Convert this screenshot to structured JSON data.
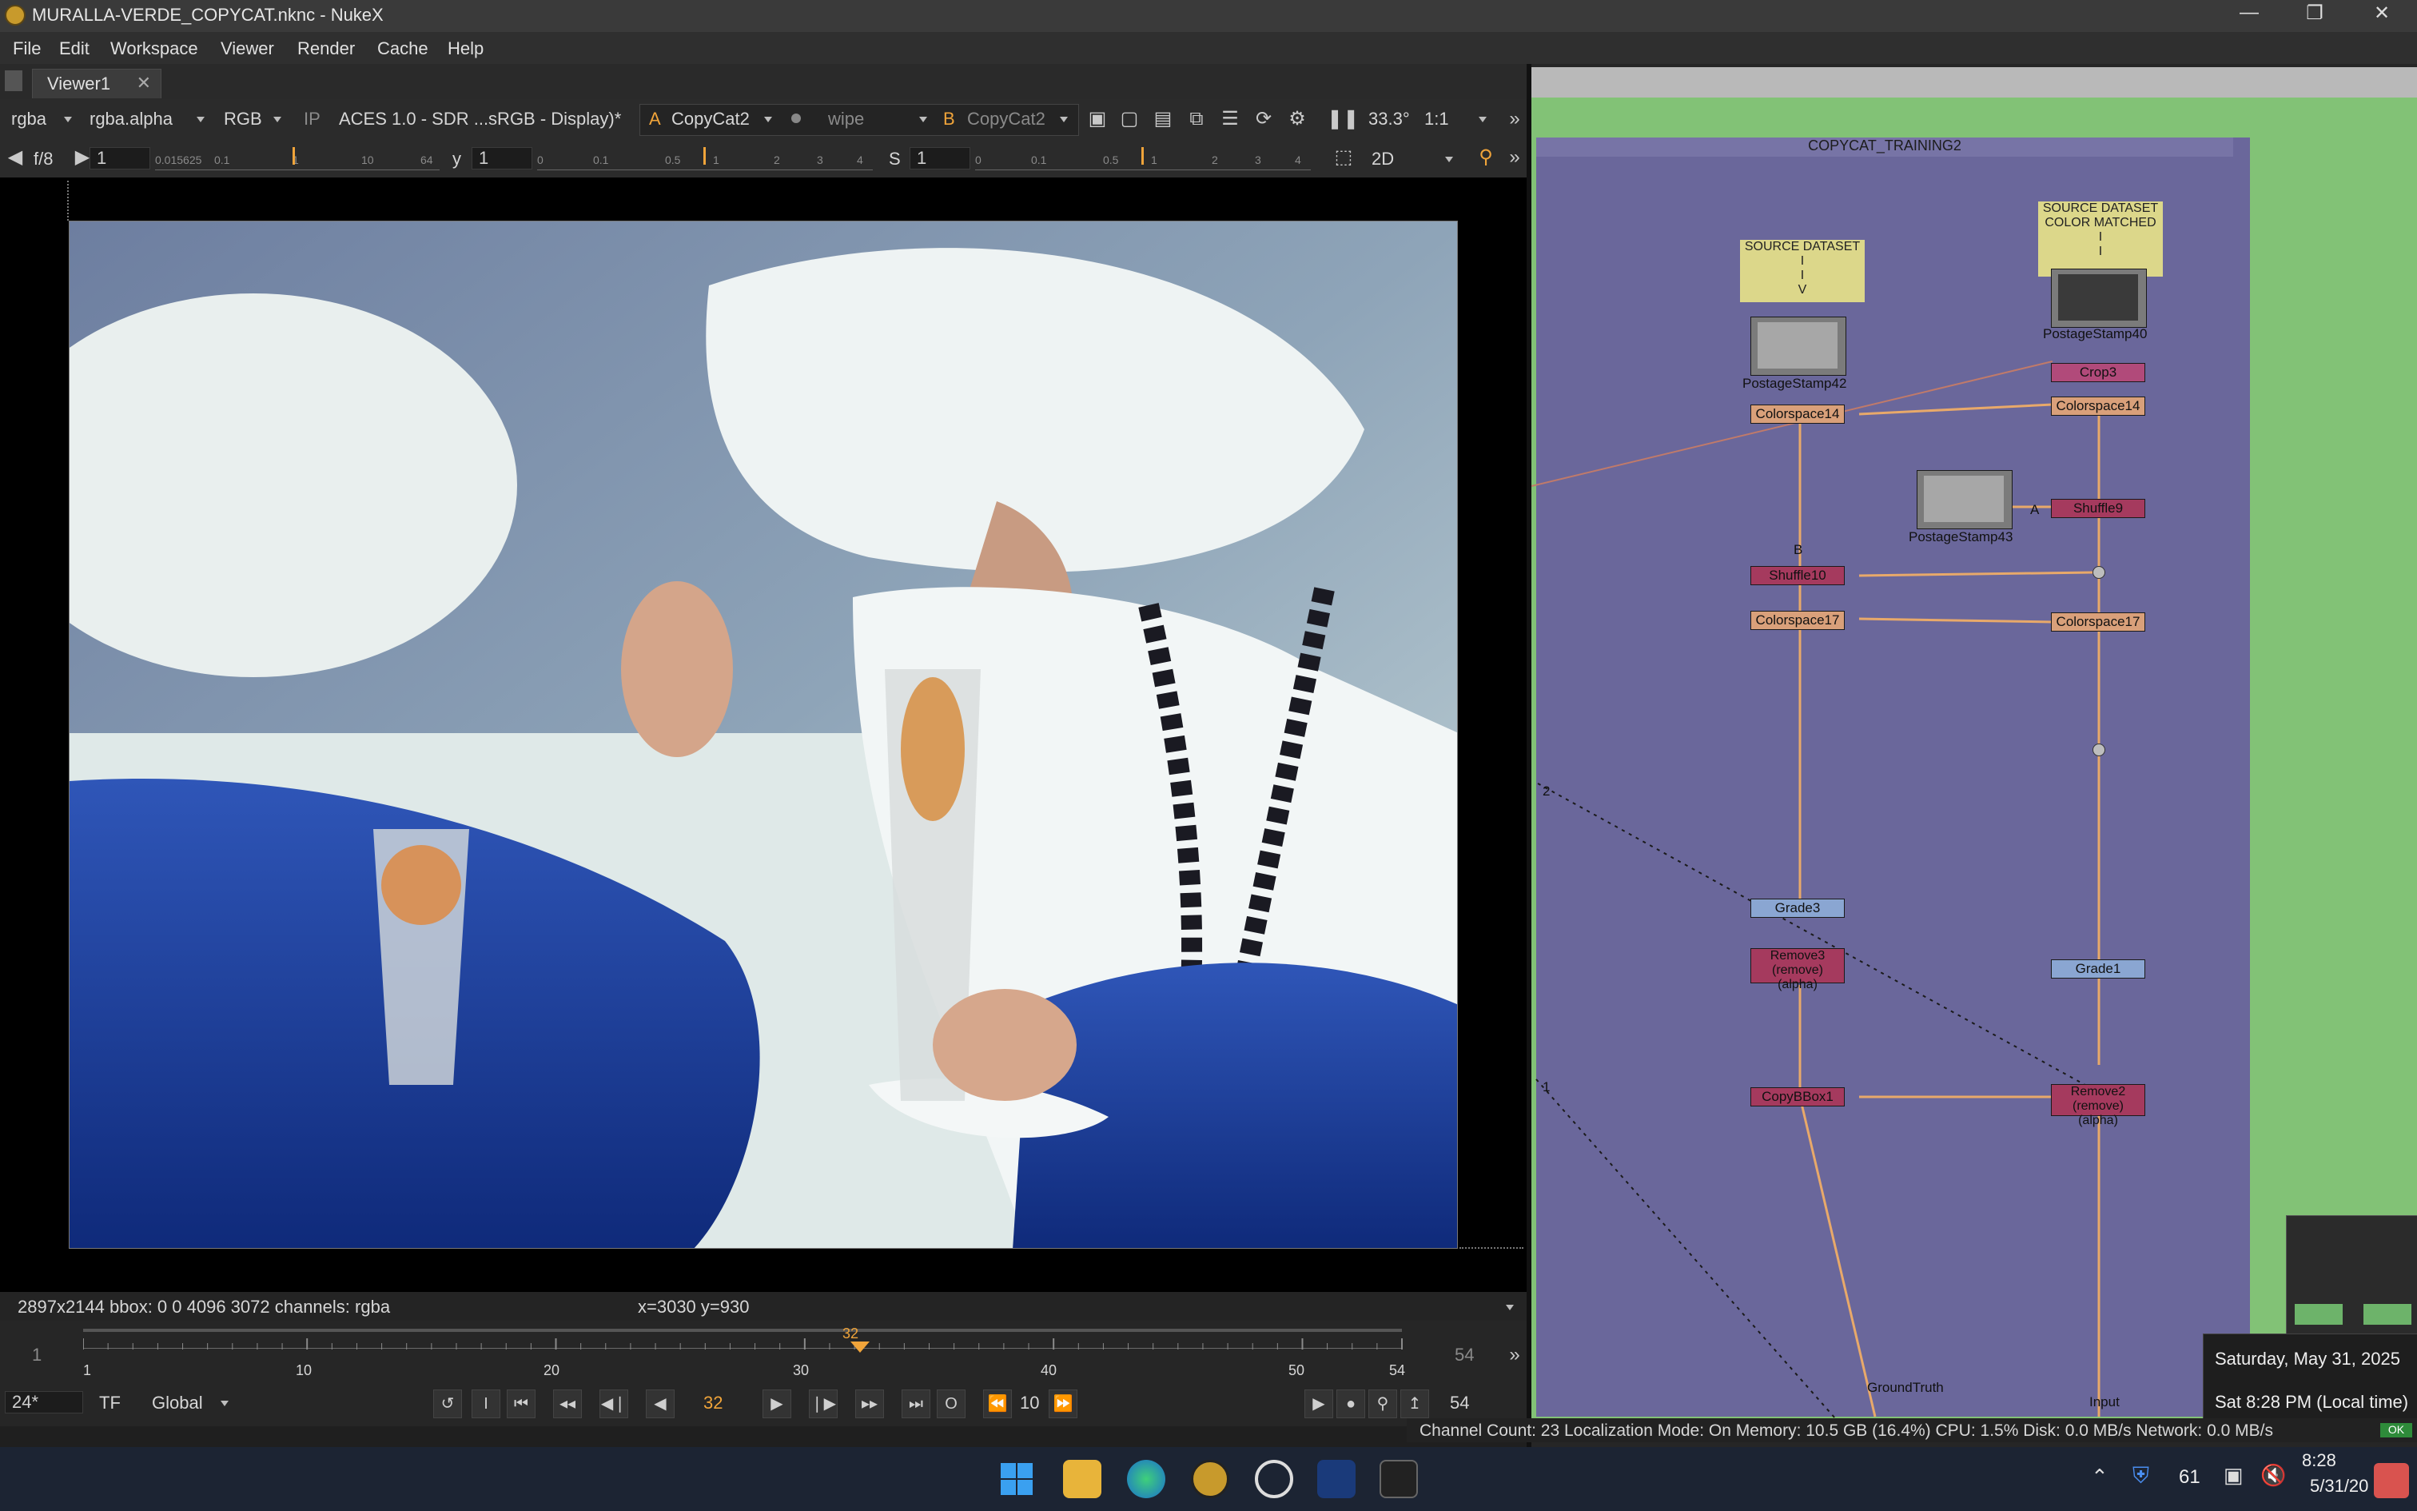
{
  "window": {
    "title": "MURALLA-VERDE_COPYCAT.nknc - NukeX"
  },
  "menu": [
    "File",
    "Edit",
    "Workspace",
    "Viewer",
    "Render",
    "Cache",
    "Help"
  ],
  "viewer": {
    "tab": "Viewer1",
    "toolbar": {
      "channels": "rgba",
      "alpha": "rgba.alpha",
      "display_channels": "RGB",
      "ip_label": "IP",
      "colorspace": "ACES 1.0 - SDR ...sRGB - Display)*",
      "a_label": "A",
      "a_input": "CopyCat2",
      "wipe": "wipe",
      "b_label": "B",
      "b_input": "CopyCat2",
      "zoom": "33.3°",
      "ratio": "1:1"
    },
    "toolbar2": {
      "fstop_label": "f/8",
      "gain": "1",
      "y_label": "y",
      "gamma": "1",
      "s_label": "S",
      "saturation": "1",
      "view_mode": "2D",
      "ruler1": [
        "0.015625",
        "0.1",
        "1",
        "10",
        "64"
      ],
      "ruler2": [
        "0",
        "0.1",
        "0.5",
        "1",
        "2",
        "3",
        "4"
      ],
      "ruler3": [
        "0",
        "0.1",
        "0.5",
        "1",
        "2",
        "3",
        "4"
      ]
    },
    "info": {
      "format": "2897x2144  bbox: 0 0 4096 3072 channels: rgba",
      "coords": "x=3030 y=930"
    },
    "timeline": {
      "start": "1",
      "end": "54",
      "current": "32",
      "ticks": [
        "1",
        "10",
        "20",
        "30",
        "40",
        "50",
        "54"
      ]
    },
    "playback": {
      "fps": "24*",
      "tf": "TF",
      "scope": "Global",
      "frame": "32",
      "step": "10",
      "out": "54",
      "i_label": "I",
      "o_label": "O"
    }
  },
  "nodegraph": {
    "backdrop_title": "COPYCAT_TRAINING2",
    "stickies": {
      "source1": [
        "SOURCE DATASET",
        "I",
        "I",
        "V"
      ],
      "source2": [
        "SOURCE DATASET",
        "COLOR MATCHED",
        "I",
        "I"
      ]
    },
    "nodes": {
      "ps42": "PostageStamp42",
      "ps40": "PostageStamp40",
      "ps43": "PostageStamp43",
      "cs14a": "Colorspace14",
      "cs14b": "Colorspace14",
      "crop3": "Crop3",
      "shuffle9": "Shuffle9",
      "shuffle10": "Shuffle10",
      "cs17a": "Colorspace17",
      "cs17b": "Colorspace17",
      "grade3": "Grade3",
      "grade1": "Grade1",
      "remove3": "Remove3 (remove) (alpha)",
      "remove2": "Remove2 (remove) (alpha)",
      "copybbox": "CopyBBox1",
      "groundtruth": "GroundTruth",
      "input": "Input"
    },
    "edge_labels": {
      "b": "B",
      "a": "A",
      "two": "2",
      "one": "1"
    }
  },
  "status": {
    "text": "Channel Count: 23  Localization Mode: On  Memory: 10.5 GB (16.4%)  CPU: 1.5%  Disk: 0.0 MB/s  Network: 0.0 MB/s",
    "badge": "OK"
  },
  "notification": {
    "date": "Saturday, May 31, 2025",
    "time": "Sat 8:28 PM (Local time)"
  },
  "taskbar": {
    "clock_time": "8:28",
    "clock_date": "5/31/20",
    "tray_count": "61"
  },
  "colors": {
    "accent": "#f0a43a",
    "backdrop": "#6a679b",
    "graph_bg": "#82c276"
  }
}
